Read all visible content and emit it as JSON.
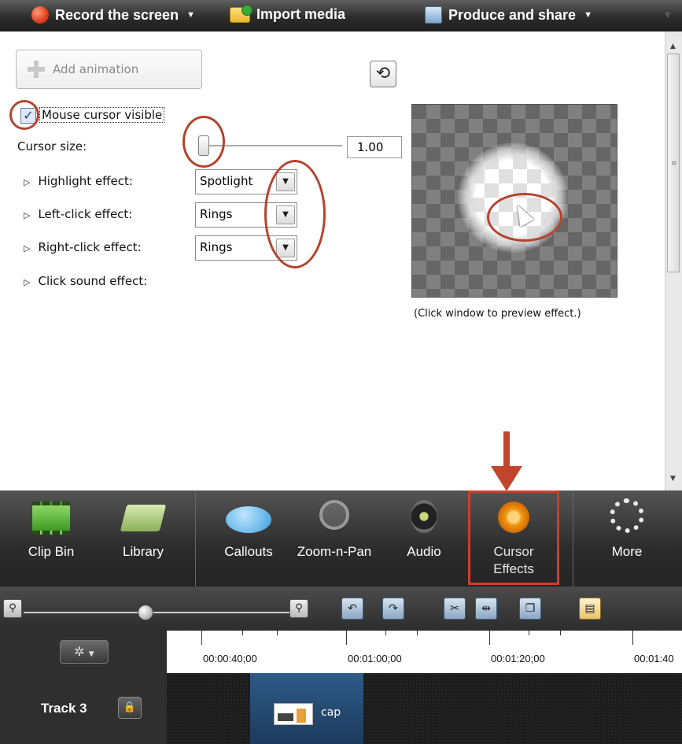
{
  "topbar": {
    "record_label": "Record the screen",
    "import_label": "Import media",
    "produce_label": "Produce and share"
  },
  "panel": {
    "add_animation": "Add animation",
    "mouse_cursor_visible": "Mouse cursor visible",
    "mouse_cursor_checked": true,
    "cursor_size_label": "Cursor size:",
    "cursor_size_value": "1.00",
    "highlight_label": "Highlight effect:",
    "highlight_value": "Spotlight",
    "left_click_label": "Left-click effect:",
    "left_click_value": "Rings",
    "right_click_label": "Right-click effect:",
    "right_click_value": "Rings",
    "click_sound_label": "Click sound effect:",
    "preview_hint": "(Click window to preview effect.)"
  },
  "tabs": [
    {
      "label": "Clip Bin"
    },
    {
      "label": "Library"
    },
    {
      "label": "Callouts"
    },
    {
      "label": "Zoom-n-Pan"
    },
    {
      "label": "Audio"
    },
    {
      "label": "Cursor Effects"
    },
    {
      "label": "More"
    }
  ],
  "timeline": {
    "times": [
      "00:00:40;00",
      "00:01:00;00",
      "00:01:20;00",
      "00:01:40"
    ],
    "track_label": "Track 3",
    "clip_label": "cap"
  },
  "colors": {
    "annotation_red": "#b3442e",
    "selected_tab_outline": "#d23b2a"
  }
}
